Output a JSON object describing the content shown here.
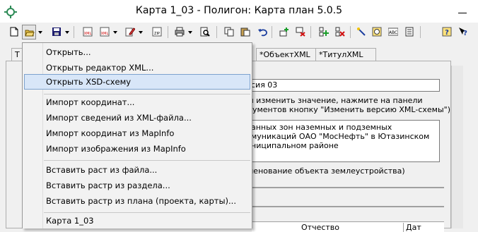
{
  "window": {
    "title": "Карта 1_03 - Полигон: Карта план 5.0.5"
  },
  "toolbar": {
    "buttons": [
      {
        "name": "new-doc-icon"
      },
      {
        "name": "open-folder-icon"
      },
      {
        "name": "save-disk-icon"
      },
      {
        "name": "xml-export-icon"
      },
      {
        "name": "xml-import-icon"
      },
      {
        "name": "edit-icon"
      },
      {
        "name": "zip-icon"
      },
      {
        "name": "print-icon"
      },
      {
        "name": "print-preview-icon"
      },
      {
        "name": "copy-icon"
      },
      {
        "name": "paste-icon"
      },
      {
        "name": "undo-icon"
      },
      {
        "name": "add-row-icon"
      },
      {
        "name": "delete-row-icon"
      },
      {
        "name": "add-block-icon"
      },
      {
        "name": "delete-block-icon"
      },
      {
        "name": "wand-icon"
      },
      {
        "name": "spellcheck-icon"
      },
      {
        "name": "abc-icon"
      },
      {
        "name": "notes-icon"
      },
      {
        "name": "help-icon"
      },
      {
        "name": "context-help-icon"
      }
    ]
  },
  "tabs": [
    {
      "label": "Т"
    },
    {
      "label": "*ОбъектXML"
    },
    {
      "label": "*ТитулXML"
    }
  ],
  "content": {
    "version_value": "сия 03",
    "version_hint": "ы изменить значение, нажмите на панели рументов кнопку \"Изменить версию XML-схемы\")",
    "description": "анных зон наземных и подземных муникаций ОАО \"МосНефть\" в Ютазинском ниципальном районе",
    "object_label": "менование объекта землеустройства)",
    "col_patronymic": "Отчество",
    "col_date": "Дат"
  },
  "menu": {
    "items": [
      {
        "label": "Открыть..."
      },
      {
        "label": "Открыть редактор XML..."
      },
      {
        "label": "Открыть XSD-схему"
      },
      {
        "label": "Импорт координат..."
      },
      {
        "label": "Импорт сведений из XML-файла..."
      },
      {
        "label": "Импорт координат из MapInfo"
      },
      {
        "label": "Импорт изображения из MapInfo"
      },
      {
        "label": "Вставить раст из файла..."
      },
      {
        "label": "Вставить растр из раздела..."
      },
      {
        "label": "Вставить растр из плана (проекта, карты)..."
      },
      {
        "label": "Карта 1_03"
      }
    ]
  },
  "colors": {
    "menu_highlight": "#d8e6f8",
    "highlight_border": "#7da2ce",
    "accent_green": "#2e8b57"
  }
}
